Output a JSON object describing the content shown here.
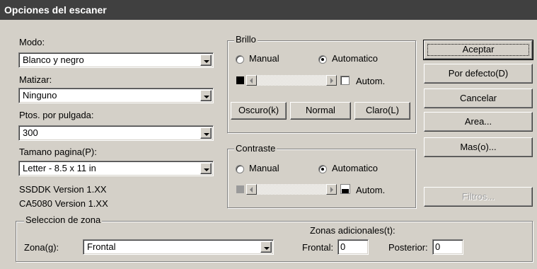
{
  "window": {
    "title": "Opciones del escaner"
  },
  "left": {
    "mode_label": "Modo:",
    "mode_value": "Blanco y negro",
    "dither_label": "Matizar:",
    "dither_value": "Ninguno",
    "dpi_label": "Ptos. por pulgada:",
    "dpi_value": "300",
    "page_label": "Tamano pagina(P):",
    "page_value": "Letter - 8.5 x 11 in",
    "version_1": "SSDDK Version 1.XX",
    "version_2": "CA5080 Version 1.XX"
  },
  "brightness": {
    "title": "Brillo",
    "manual_label": "Manual",
    "auto_label": "Automatico",
    "selected": "Automatico",
    "auto_check_label": "Autom.",
    "auto_checked": false,
    "dark_button": "Oscuro(k)",
    "normal_button": "Normal",
    "light_button": "Claro(L)"
  },
  "contrast": {
    "title": "Contraste",
    "manual_label": "Manual",
    "auto_label": "Automatico",
    "selected": "Automatico",
    "auto_check_label": "Autom.",
    "auto_checked": false
  },
  "buttons": {
    "accept": "Aceptar",
    "default": "Por defecto(D)",
    "cancel": "Cancelar",
    "area": "Area...",
    "more": "Mas(o)...",
    "filters": "Filtros..."
  },
  "zone": {
    "title": "Seleccion de zona",
    "zone_label": "Zona(g):",
    "zone_value": "Frontal",
    "extra_label": "Zonas adicionales(t):",
    "front_label": "Frontal:",
    "front_value": "0",
    "back_label": "Posterior:",
    "back_value": "0"
  }
}
